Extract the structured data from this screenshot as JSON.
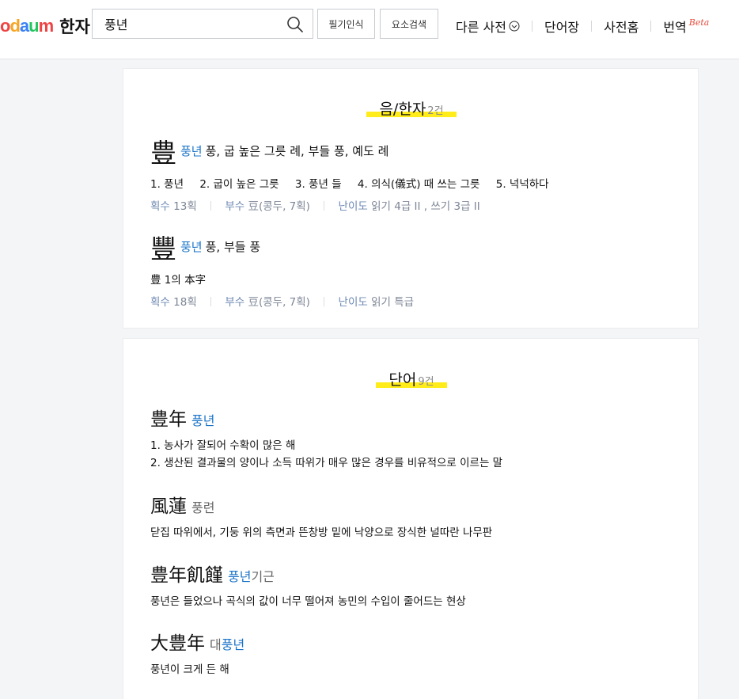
{
  "header": {
    "logo_text": "daum",
    "service_title": "한자",
    "search_value": "풍년",
    "handwriting_button": "필기인식",
    "element_search_button": "요소검색",
    "nav": [
      {
        "label": "다른 사전"
      },
      {
        "label": "단어장"
      },
      {
        "label": "사전홈"
      },
      {
        "label": "번역",
        "badge": "Beta"
      }
    ]
  },
  "section_hanja": {
    "title": "음/한자",
    "count": "2건",
    "entries": [
      {
        "hanja": "豊",
        "reading": "풍년",
        "meaning": "풍, 굽 높은 그릇 례, 부들 풍, 예도 례",
        "definitions": [
          "1. 풍년",
          "2. 굽이 높은 그릇",
          "3. 풍년 들",
          "4. 의식(儀式) 때 쓰는 그릇",
          "5. 넉넉하다"
        ],
        "strokes_key": "획수",
        "strokes_val": "13획",
        "radical_key": "부수",
        "radical_val": "豆(콩두, 7획)",
        "level_key": "난이도",
        "level_val": "읽기 4급 II , 쓰기 3급 II"
      },
      {
        "hanja": "豐",
        "reading": "풍년",
        "meaning": "풍, 부들 풍",
        "definitions": [
          "豊 1의 本字"
        ],
        "strokes_key": "획수",
        "strokes_val": "18획",
        "radical_key": "부수",
        "radical_val": "豆(콩두, 7획)",
        "level_key": "난이도",
        "level_val": "읽기 특급"
      }
    ]
  },
  "section_word": {
    "title": "단어",
    "count": "9건",
    "words": [
      {
        "hanja": "豊年",
        "reading_blue": "풍년",
        "reading_gray": "",
        "defs": [
          "1. 농사가 잘되어 수확이 많은 해",
          "2. 생산된 결과물의 양이나 소득 따위가 매우 많은 경우를 비유적으로 이르는 말"
        ]
      },
      {
        "hanja": "風蓮",
        "reading_blue": "",
        "reading_gray": "풍련",
        "defs": [
          "닫집 따위에서, 기둥 위의 측면과 뜬창방 밑에 낙양으로 장식한 널따란 나무판"
        ]
      },
      {
        "hanja": "豊年飢饉",
        "reading_blue": "풍년",
        "reading_gray": "기근",
        "defs": [
          "풍년은 들었으나 곡식의 값이 너무 떨어져 농민의 수입이 줄어드는 현상"
        ]
      },
      {
        "hanja": "大豊年",
        "reading_prefix": "대",
        "reading_blue": "풍년",
        "reading_gray": "",
        "defs": [
          "풍년이 크게 든 해"
        ]
      }
    ]
  }
}
